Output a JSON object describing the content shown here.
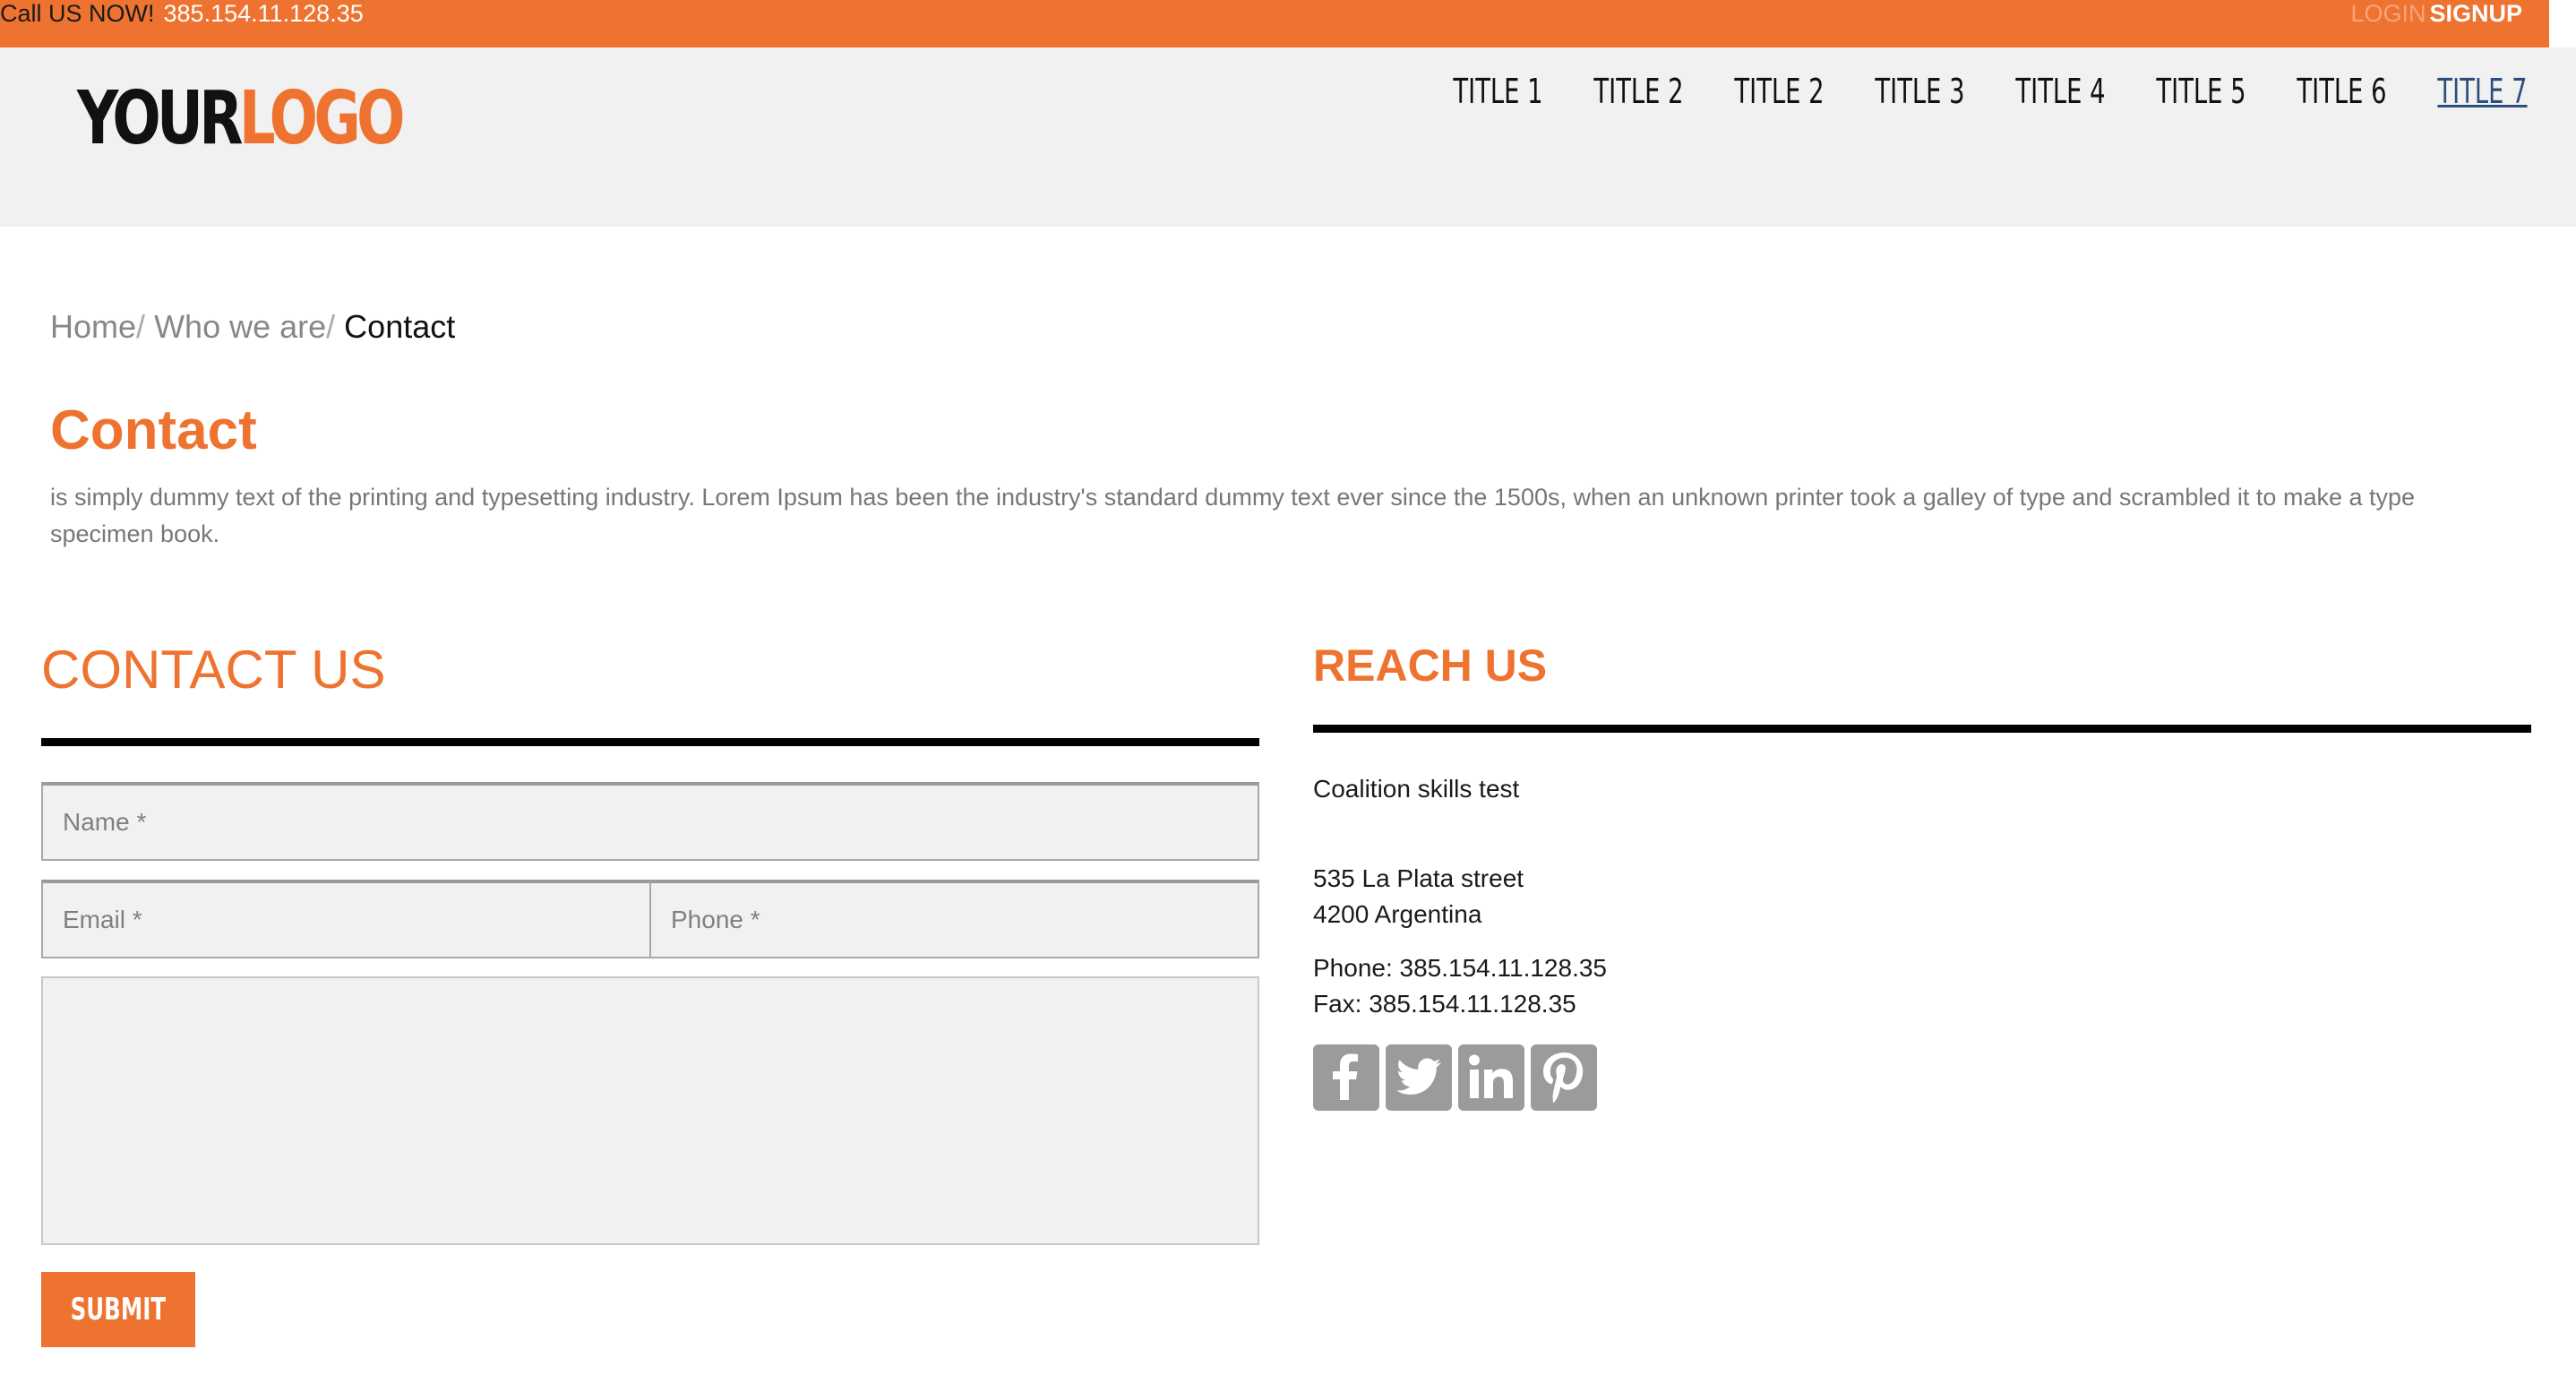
{
  "topbar": {
    "call_label": "Call US NOW!",
    "phone": "385.154.11.128.35",
    "login": "LOGIN",
    "signup": "SIGNUP"
  },
  "logo": {
    "part1": "YOUR",
    "part2": "LOGO"
  },
  "nav": {
    "items": [
      {
        "label": "TITLE 1"
      },
      {
        "label": "TITLE 2"
      },
      {
        "label": "TITLE 2"
      },
      {
        "label": "TITLE 3"
      },
      {
        "label": "TITLE 4"
      },
      {
        "label": "TITLE 5"
      },
      {
        "label": "TITLE 6"
      },
      {
        "label": "TITLE 7",
        "active": true
      }
    ]
  },
  "breadcrumb": {
    "home": "Home",
    "who": "Who we are",
    "current": "Contact",
    "separator": "/"
  },
  "page": {
    "title": "Contact",
    "intro": "is simply dummy text of the printing and typesetting industry. Lorem Ipsum has been the industry's standard dummy text ever since the 1500s, when an unknown printer took a galley of type and scrambled it to make a type specimen book."
  },
  "contact_form": {
    "heading": "CONTACT US",
    "name_placeholder": "Name *",
    "email_placeholder": "Email *",
    "phone_placeholder": "Phone *",
    "message_placeholder": "",
    "submit_label": "SUBMIT"
  },
  "reach_us": {
    "heading": "REACH US",
    "organization": "Coalition skills test",
    "address_line1": "535 La Plata street",
    "address_line2": "4200 Argentina",
    "phone": "Phone: 385.154.11.128.35",
    "fax": "Fax: 385.154.11.128.35",
    "social": [
      "facebook-icon",
      "twitter-icon",
      "linkedin-icon",
      "pinterest-icon"
    ]
  },
  "colors": {
    "accent": "#ee7330",
    "header_bg": "#f1f1f1",
    "nav_active": "#2a4f7c",
    "social_icon_bg": "#9b9b9b"
  }
}
